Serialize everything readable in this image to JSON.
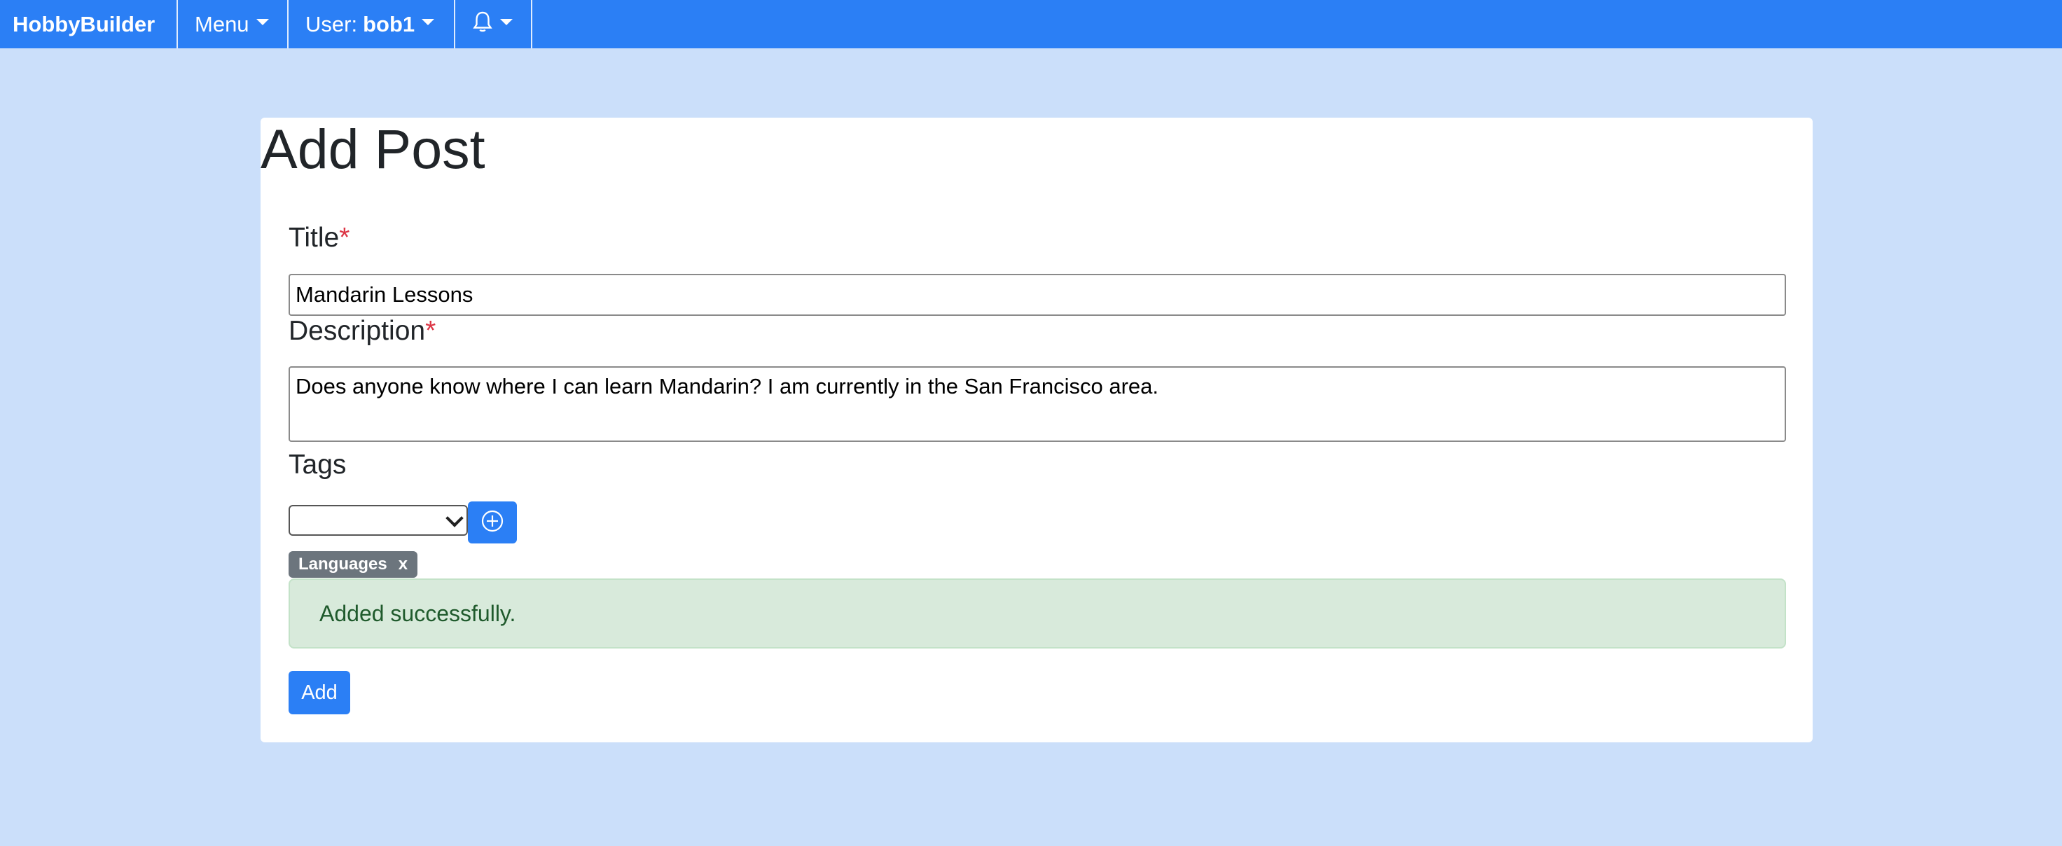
{
  "navbar": {
    "brand": "HobbyBuilder",
    "menu_label": "Menu",
    "user_prefix": "User:",
    "username": "bob1"
  },
  "form": {
    "page_title": "Add Post",
    "title_label": "Title",
    "required_mark": "*",
    "title_value": "Mandarin Lessons",
    "description_label": "Description",
    "description_value": "Does anyone know where I can learn Mandarin? I am currently in the San Francisco area.",
    "tags_label": "Tags",
    "tags_selected": "",
    "tags": [
      {
        "label": "Languages",
        "remove": "x"
      }
    ],
    "alert_text": "Added successfully.",
    "submit_label": "Add"
  },
  "icons": [
    "bell-icon",
    "plus-circle-icon",
    "chevron-down-icon"
  ],
  "colors": {
    "primary": "#2b7ff5",
    "page_background": "#cbdffa",
    "required": "#dc3545",
    "alert_background": "#d8eadb",
    "badge": "#6c757d"
  }
}
